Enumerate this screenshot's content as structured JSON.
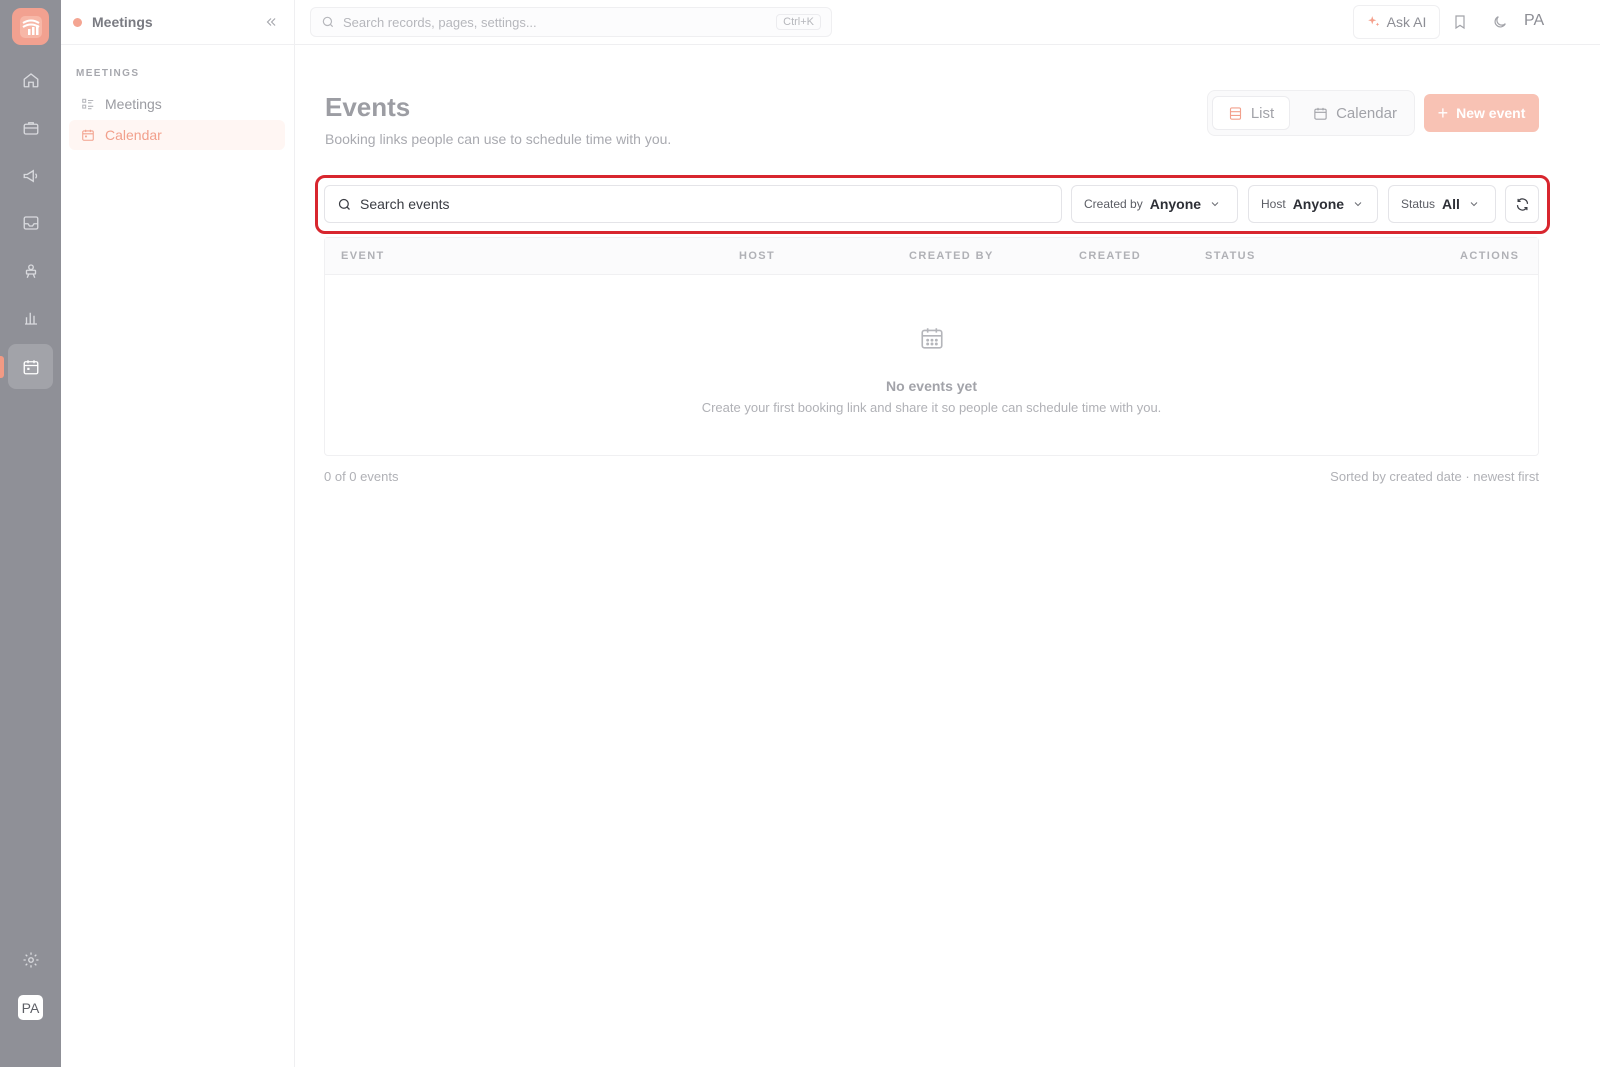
{
  "colors": {
    "rail_bg": "#8f9097",
    "accent": "#f29a84",
    "highlight_border": "#d8262e",
    "primary_button_bg": "#f8c2b4"
  },
  "rail": {
    "logo_icon": "app-logo",
    "items": [
      {
        "name": "home",
        "icon": "home-icon"
      },
      {
        "name": "briefcase",
        "icon": "briefcase-icon"
      },
      {
        "name": "campaigns",
        "icon": "megaphone-icon"
      },
      {
        "name": "inbox",
        "icon": "inbox-icon"
      },
      {
        "name": "training",
        "icon": "presentation-icon"
      },
      {
        "name": "reports",
        "icon": "bar-chart-icon"
      },
      {
        "name": "meetings",
        "icon": "calendar-icon",
        "active": true
      }
    ],
    "settings_icon": "gear-icon",
    "avatar_initials": "PA"
  },
  "sidebar": {
    "title": "Meetings",
    "collapse_icon": "double-chevron-left-icon",
    "section_label": "MEETINGS",
    "items": [
      {
        "label": "Meetings",
        "icon": "list-icon",
        "active": false
      },
      {
        "label": "Calendar",
        "icon": "calendar-icon",
        "active": true
      }
    ]
  },
  "topbar": {
    "search_placeholder": "Search records, pages, settings...",
    "search_shortcut": "Ctrl+K",
    "ask_ai_label": "Ask AI",
    "user_initials": "PA"
  },
  "page": {
    "title": "Events",
    "subtitle": "Booking links people can use to schedule time with you.",
    "view_list_label": "List",
    "view_calendar_label": "Calendar",
    "active_view": "List",
    "new_event_label": "New event"
  },
  "filters": {
    "search_placeholder": "Search events",
    "created_by": {
      "label": "Created by",
      "value": "Anyone"
    },
    "host": {
      "label": "Host",
      "value": "Anyone"
    },
    "status": {
      "label": "Status",
      "value": "All"
    },
    "refresh_icon": "refresh-icon"
  },
  "table": {
    "columns": [
      "EVENT",
      "HOST",
      "CREATED BY",
      "CREATED",
      "STATUS",
      "ACTIONS"
    ],
    "rows": [],
    "empty_title": "No events yet",
    "empty_subtitle": "Create your first booking link and share it so people can schedule time with you."
  },
  "footer": {
    "count_text": "0 of 0 events",
    "sort_text": "Sorted by created date · newest first"
  }
}
